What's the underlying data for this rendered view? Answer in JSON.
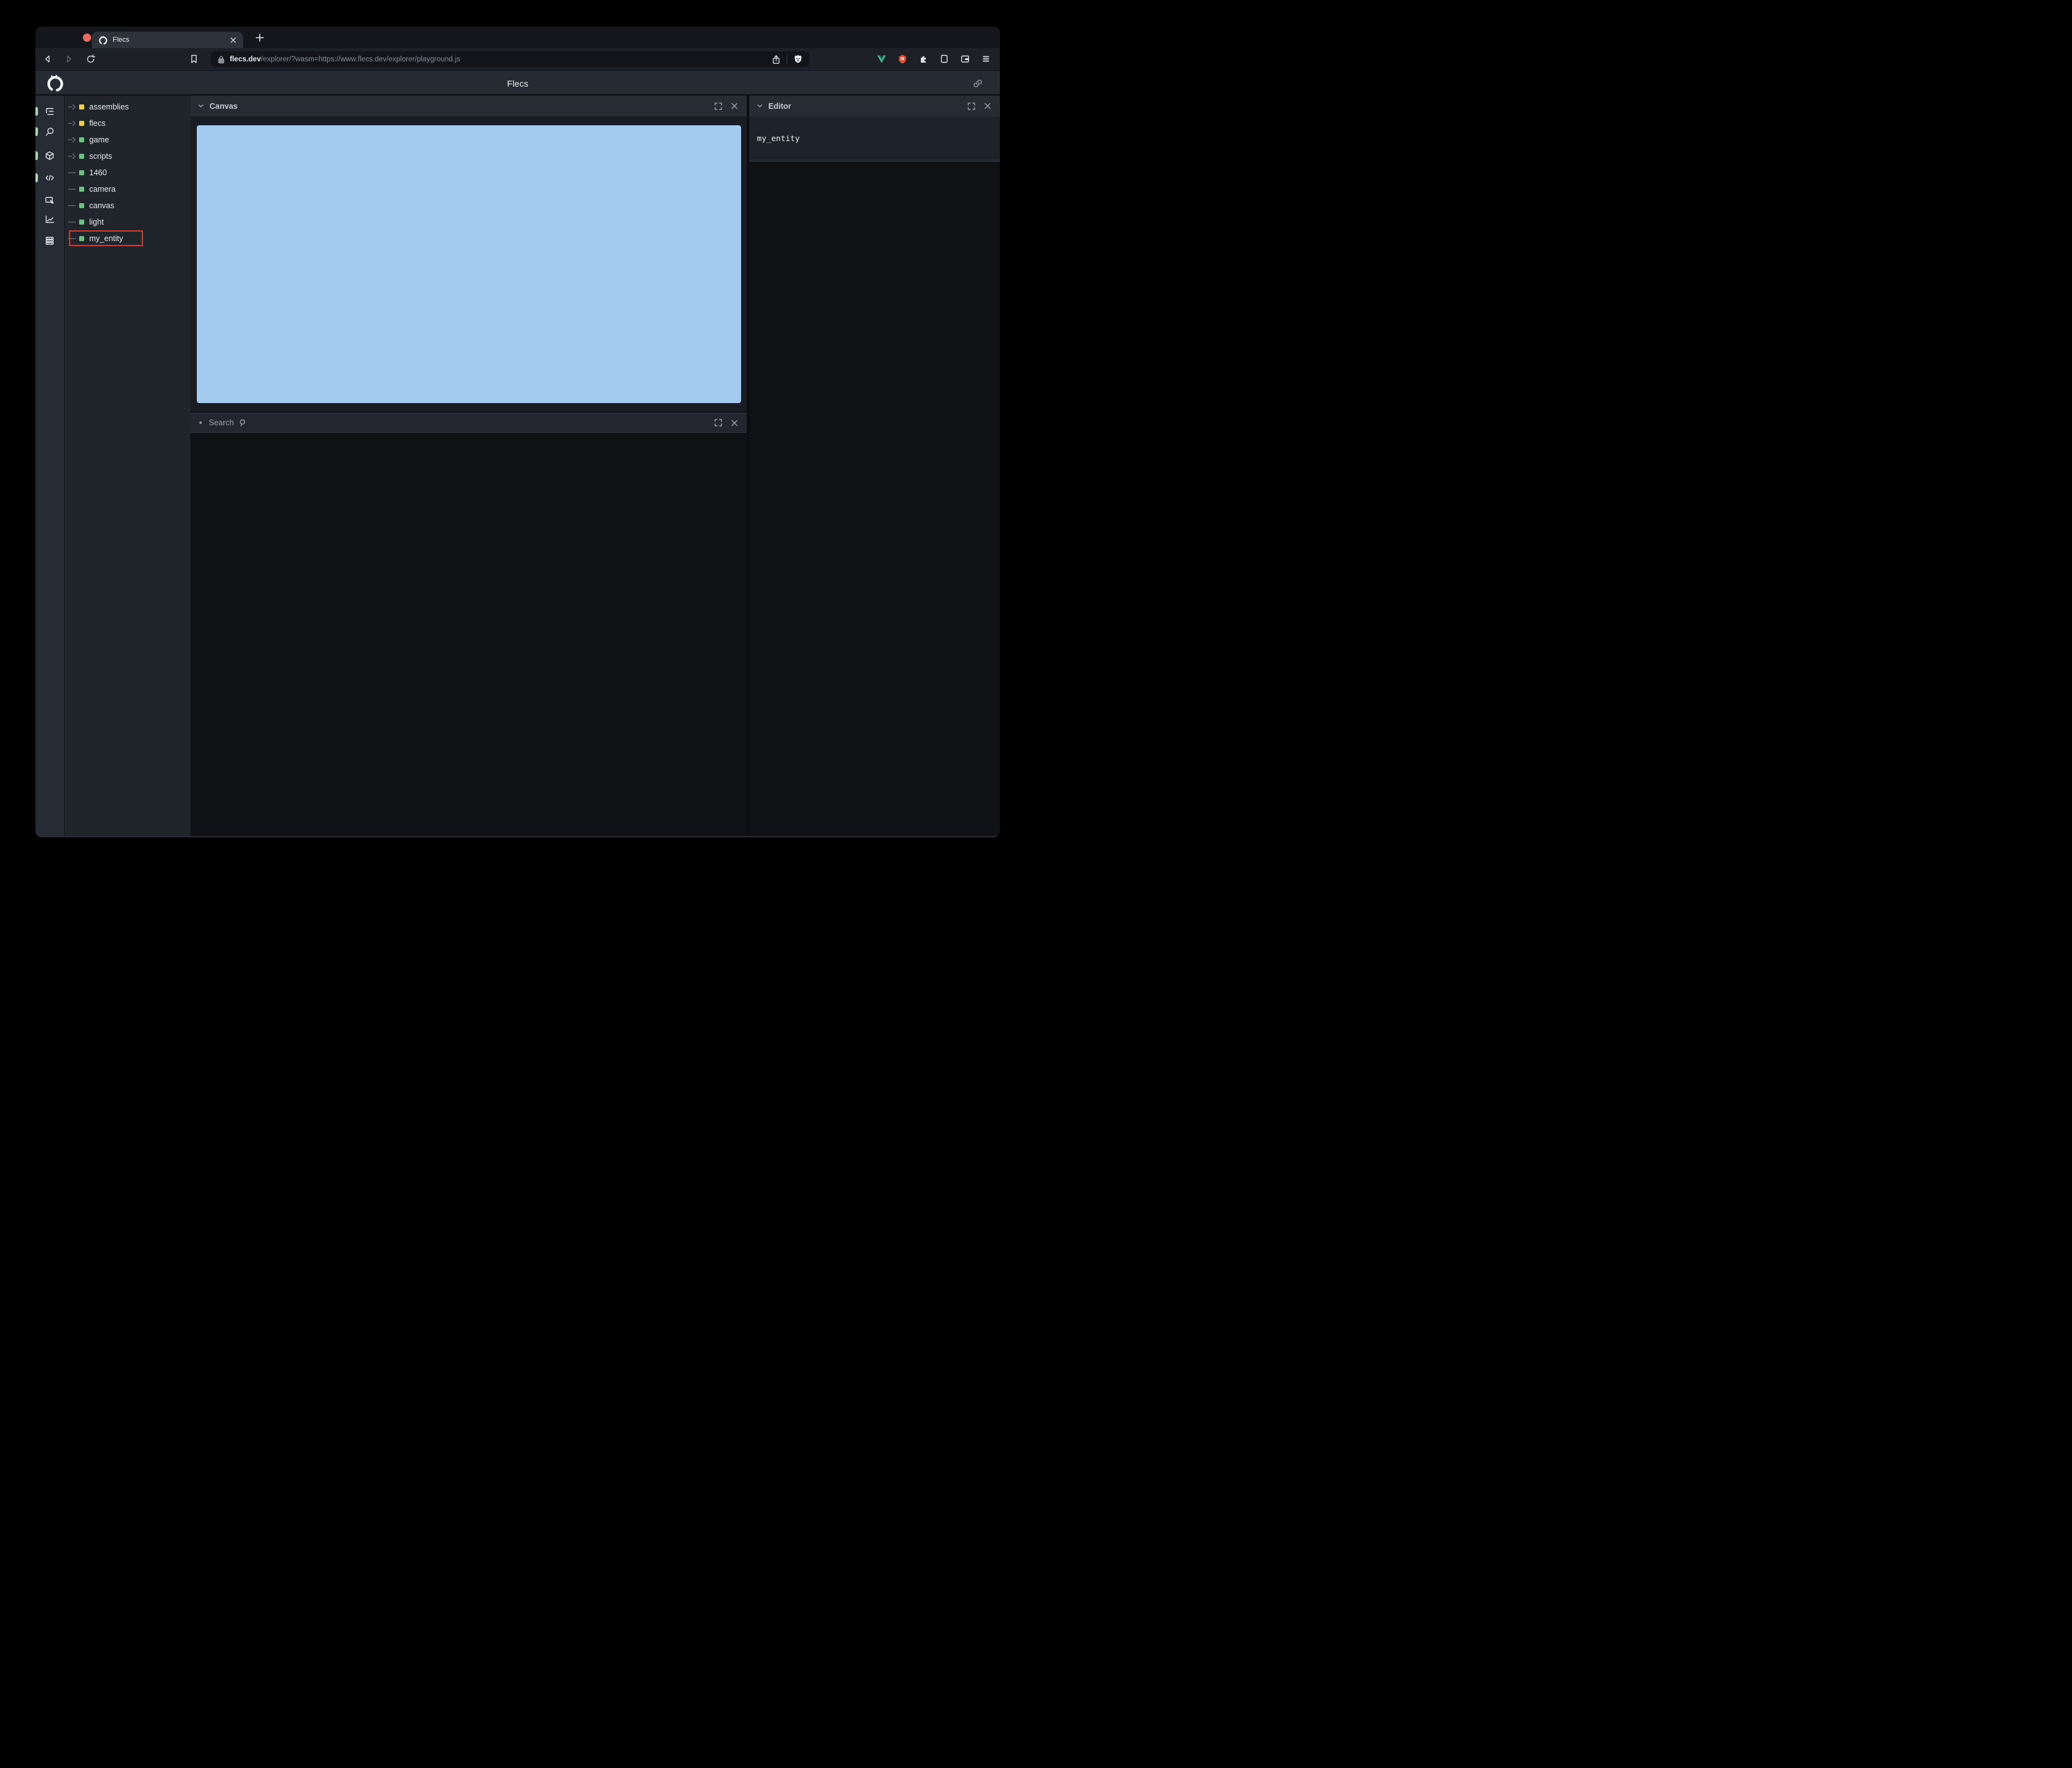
{
  "window": {
    "traffic_lights": [
      "close-button",
      "minimize-button",
      "maximize-button"
    ]
  },
  "tab": {
    "title": "Flecs",
    "favicon": "flecs-logo-icon"
  },
  "toolbar": {
    "nav_icons": [
      "back-icon",
      "forward-icon",
      "reload-icon",
      "bookmark-icon"
    ],
    "url_domain": "flecs.dev",
    "url_path": "/explorer/?wasm=https://www.flecs.dev/explorer/playground.js",
    "url_left_icon": "lock-icon",
    "url_right_icons": [
      "share-icon",
      "brave-lion-icon"
    ],
    "right_icons": [
      "vue-devtools-icon",
      "shield-extension-icon",
      "extensions-puzzle-icon",
      "sidebar-toggle-icon",
      "wallet-icon",
      "menu-icon"
    ]
  },
  "app_header": {
    "title": "Flecs",
    "logo": "flecs-logo-icon",
    "right_icon": "link-icon"
  },
  "side_nav": {
    "active_color": "#a9d3b2",
    "items": [
      {
        "icon": "tree-icon",
        "active": true
      },
      {
        "icon": "search-icon",
        "active": true
      },
      {
        "icon": "entities-cube-icon",
        "active": true
      },
      {
        "icon": "code-icon",
        "active": true
      },
      {
        "icon": "inspector-icon",
        "active": false
      },
      {
        "icon": "stats-chart-icon",
        "active": false
      },
      {
        "icon": "memory-icon",
        "active": false
      }
    ]
  },
  "tree": {
    "highlight_color": "#d23b2a",
    "items": [
      {
        "label": "assemblies",
        "square_color": "#eccf4b",
        "expandable": true,
        "highlighted": false
      },
      {
        "label": "flecs",
        "square_color": "#eccf4b",
        "expandable": true,
        "highlighted": false
      },
      {
        "label": "game",
        "square_color": "#70bd84",
        "expandable": true,
        "highlighted": false
      },
      {
        "label": "scripts",
        "square_color": "#70bd84",
        "expandable": true,
        "highlighted": false
      },
      {
        "label": "1460",
        "square_color": "#70bd84",
        "expandable": false,
        "highlighted": false
      },
      {
        "label": "camera",
        "square_color": "#70bd84",
        "expandable": false,
        "highlighted": false
      },
      {
        "label": "canvas",
        "square_color": "#70bd84",
        "expandable": false,
        "highlighted": false
      },
      {
        "label": "light",
        "square_color": "#70bd84",
        "expandable": false,
        "highlighted": false
      },
      {
        "label": "my_entity",
        "square_color": "#70bd84",
        "expandable": false,
        "highlighted": true
      }
    ]
  },
  "panel_controls": {
    "icons": [
      "fullscreen-icon",
      "close-icon"
    ]
  },
  "canvas_panel": {
    "title": "Canvas",
    "collapse_icon": "chevron-down-icon",
    "canvas_color": "#a3cbef"
  },
  "search_panel": {
    "title": "Search",
    "bullet_icon": "dot-icon",
    "search_glyph": "magnifier-icon"
  },
  "editor_panel": {
    "title": "Editor",
    "collapse_icon": "chevron-down-icon",
    "content": "my_entity"
  }
}
